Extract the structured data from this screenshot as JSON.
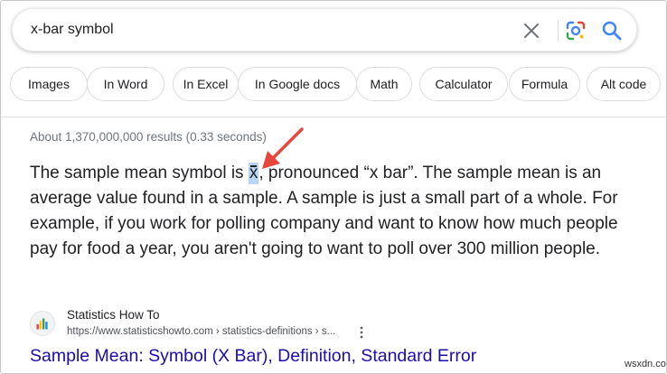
{
  "search": {
    "query": "x-bar symbol"
  },
  "icons": {
    "clear": "close-icon",
    "lens": "google-lens-icon",
    "search": "search-icon",
    "more": "more-vert-icon"
  },
  "chips": [
    {
      "label": "Images"
    },
    {
      "label": "In Word"
    },
    {
      "label": "In Excel"
    },
    {
      "label": "In Google docs"
    },
    {
      "label": "Math"
    },
    {
      "label": "Calculator"
    },
    {
      "label": "Formula"
    },
    {
      "label": "Alt code"
    }
  ],
  "results": {
    "count_text": "About 1,370,000,000 results (0.33 seconds)"
  },
  "snippet": {
    "before": "The sample mean symbol is ",
    "symbol": "x",
    "after": ", pronounced “x bar”. The sample mean is an average value found in a sample. A sample is just a small part of a whole. For example, if you work for polling company and want to know how much people pay for food a year, you aren't going to want to poll over 300 million people."
  },
  "source": {
    "name": "Statistics How To",
    "url": "https://www.statisticshowto.com › statistics-definitions › s..."
  },
  "result_title": "Sample Mean: Symbol (X Bar), Definition, Standard Error",
  "watermark": "wsxdn.com",
  "colors": {
    "link": "#1a0dab",
    "highlight": "#b9d5f5",
    "annotation_arrow": "#e8453c"
  }
}
